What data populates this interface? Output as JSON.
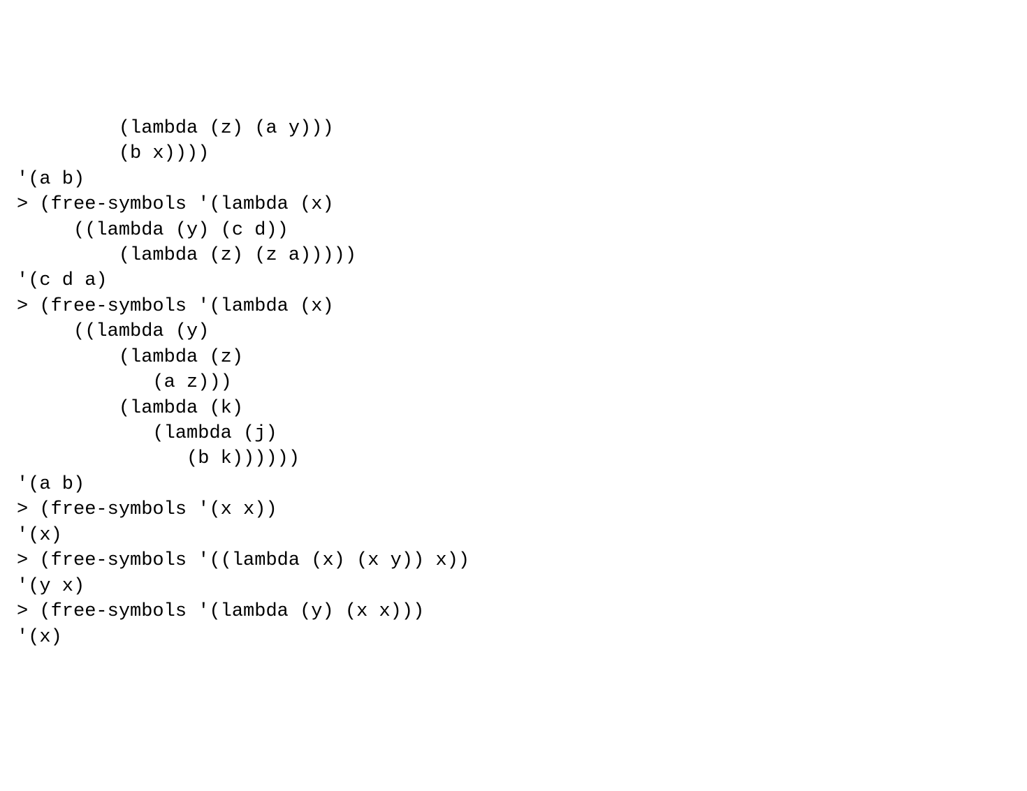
{
  "lines": [
    "         (lambda (z) (a y)))",
    "         (b x))))",
    "'(a b)",
    "> (free-symbols '(lambda (x)",
    "     ((lambda (y) (c d))",
    "         (lambda (z) (z a)))))",
    "'(c d a)",
    "> (free-symbols '(lambda (x)",
    "     ((lambda (y)",
    "         (lambda (z)",
    "            (a z)))",
    "         (lambda (k)",
    "            (lambda (j)",
    "               (b k))))))",
    "'(a b)",
    "> (free-symbols '(x x))",
    "'(x)",
    "> (free-symbols '((lambda (x) (x y)) x))",
    "'(y x)",
    "> (free-symbols '(lambda (y) (x x)))",
    "'(x)"
  ]
}
